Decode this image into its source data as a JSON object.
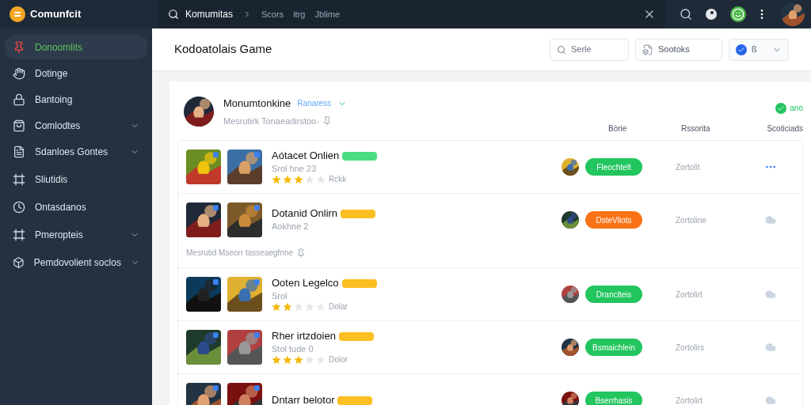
{
  "app": {
    "name": "Comunfcit"
  },
  "topbar": {
    "tab_title": "Komumitas",
    "crumbs": [
      "Scors",
      "itrg",
      "Jblime"
    ]
  },
  "sidebar": {
    "items": [
      {
        "label": "Donoomlits",
        "expandable": false,
        "selected": true
      },
      {
        "label": "Dotinge",
        "expandable": false,
        "selected": false
      },
      {
        "label": "Bantoing",
        "expandable": false,
        "selected": false
      },
      {
        "label": "Comlodtes",
        "expandable": true,
        "selected": false
      },
      {
        "label": "Sdanloes Gontes",
        "expandable": true,
        "selected": false
      },
      {
        "label": "Sliutidis",
        "expandable": false,
        "selected": false
      },
      {
        "label": "Ontasdanos",
        "expandable": false,
        "selected": false
      },
      {
        "label": "Pmeropteis",
        "expandable": true,
        "selected": false
      },
      {
        "label": "Pemdovolient soclos",
        "expandable": true,
        "selected": false
      }
    ]
  },
  "header": {
    "title": "Kodoatolais Game",
    "search": {
      "placeholder": "Serle"
    },
    "button": "Sootoks",
    "dropdown": "ß"
  },
  "profile": {
    "name": "Monumtonkine",
    "link": "Ranaress",
    "note": "Mesrutirk Tonaeadirstoo-",
    "status": "ano"
  },
  "columns": [
    "Bòrie",
    "Rssorita",
    "Scoticiads"
  ],
  "rows": [
    {
      "kind": "more",
      "name": "Aótacet Onlien",
      "badge": {
        "color": "#4ade80"
      },
      "subtitle": "Srol hne 23",
      "rating": {
        "stars": 3,
        "text": "Rckk"
      },
      "status": {
        "label": "Fleochtelt",
        "color": "#22c55e"
      },
      "value": "Zortolit"
    },
    {
      "kind": "cloud",
      "name": "Dotanid Onlirn",
      "badge": {
        "color": "#fbbf24"
      },
      "subtitle": "Aokhne 2",
      "status": {
        "label": "DsteVliots",
        "color": "#f97316"
      },
      "value": "Zortoline",
      "note": "Mesrutid Mseorr tasseaegfnne"
    },
    {
      "kind": "cloud",
      "name": "Ooten Legelco",
      "badge": {
        "color": "#fbbf24"
      },
      "subtitle": "Srol",
      "rating": {
        "stars": 2,
        "text": "Dolar"
      },
      "status": {
        "label": "Dranclteis",
        "color": "#22c55e"
      },
      "value": "Zortolirt"
    },
    {
      "kind": "cloud",
      "name": "Rher irtzdoien",
      "badge": {
        "color": "#fbbf24"
      },
      "subtitle": "Stol tude 0",
      "rating": {
        "stars": 3,
        "text": "Dolor"
      },
      "status": {
        "label": "Bsmaichlein",
        "color": "#22c55e"
      },
      "value": "Zortolirs"
    },
    {
      "kind": "cloud",
      "name": "Dntarr belotor",
      "badge": {
        "color": "#fbbf24"
      },
      "status": {
        "label": "Bserrhasis",
        "color": "#22c55e"
      },
      "value": "Zortolirt"
    }
  ]
}
